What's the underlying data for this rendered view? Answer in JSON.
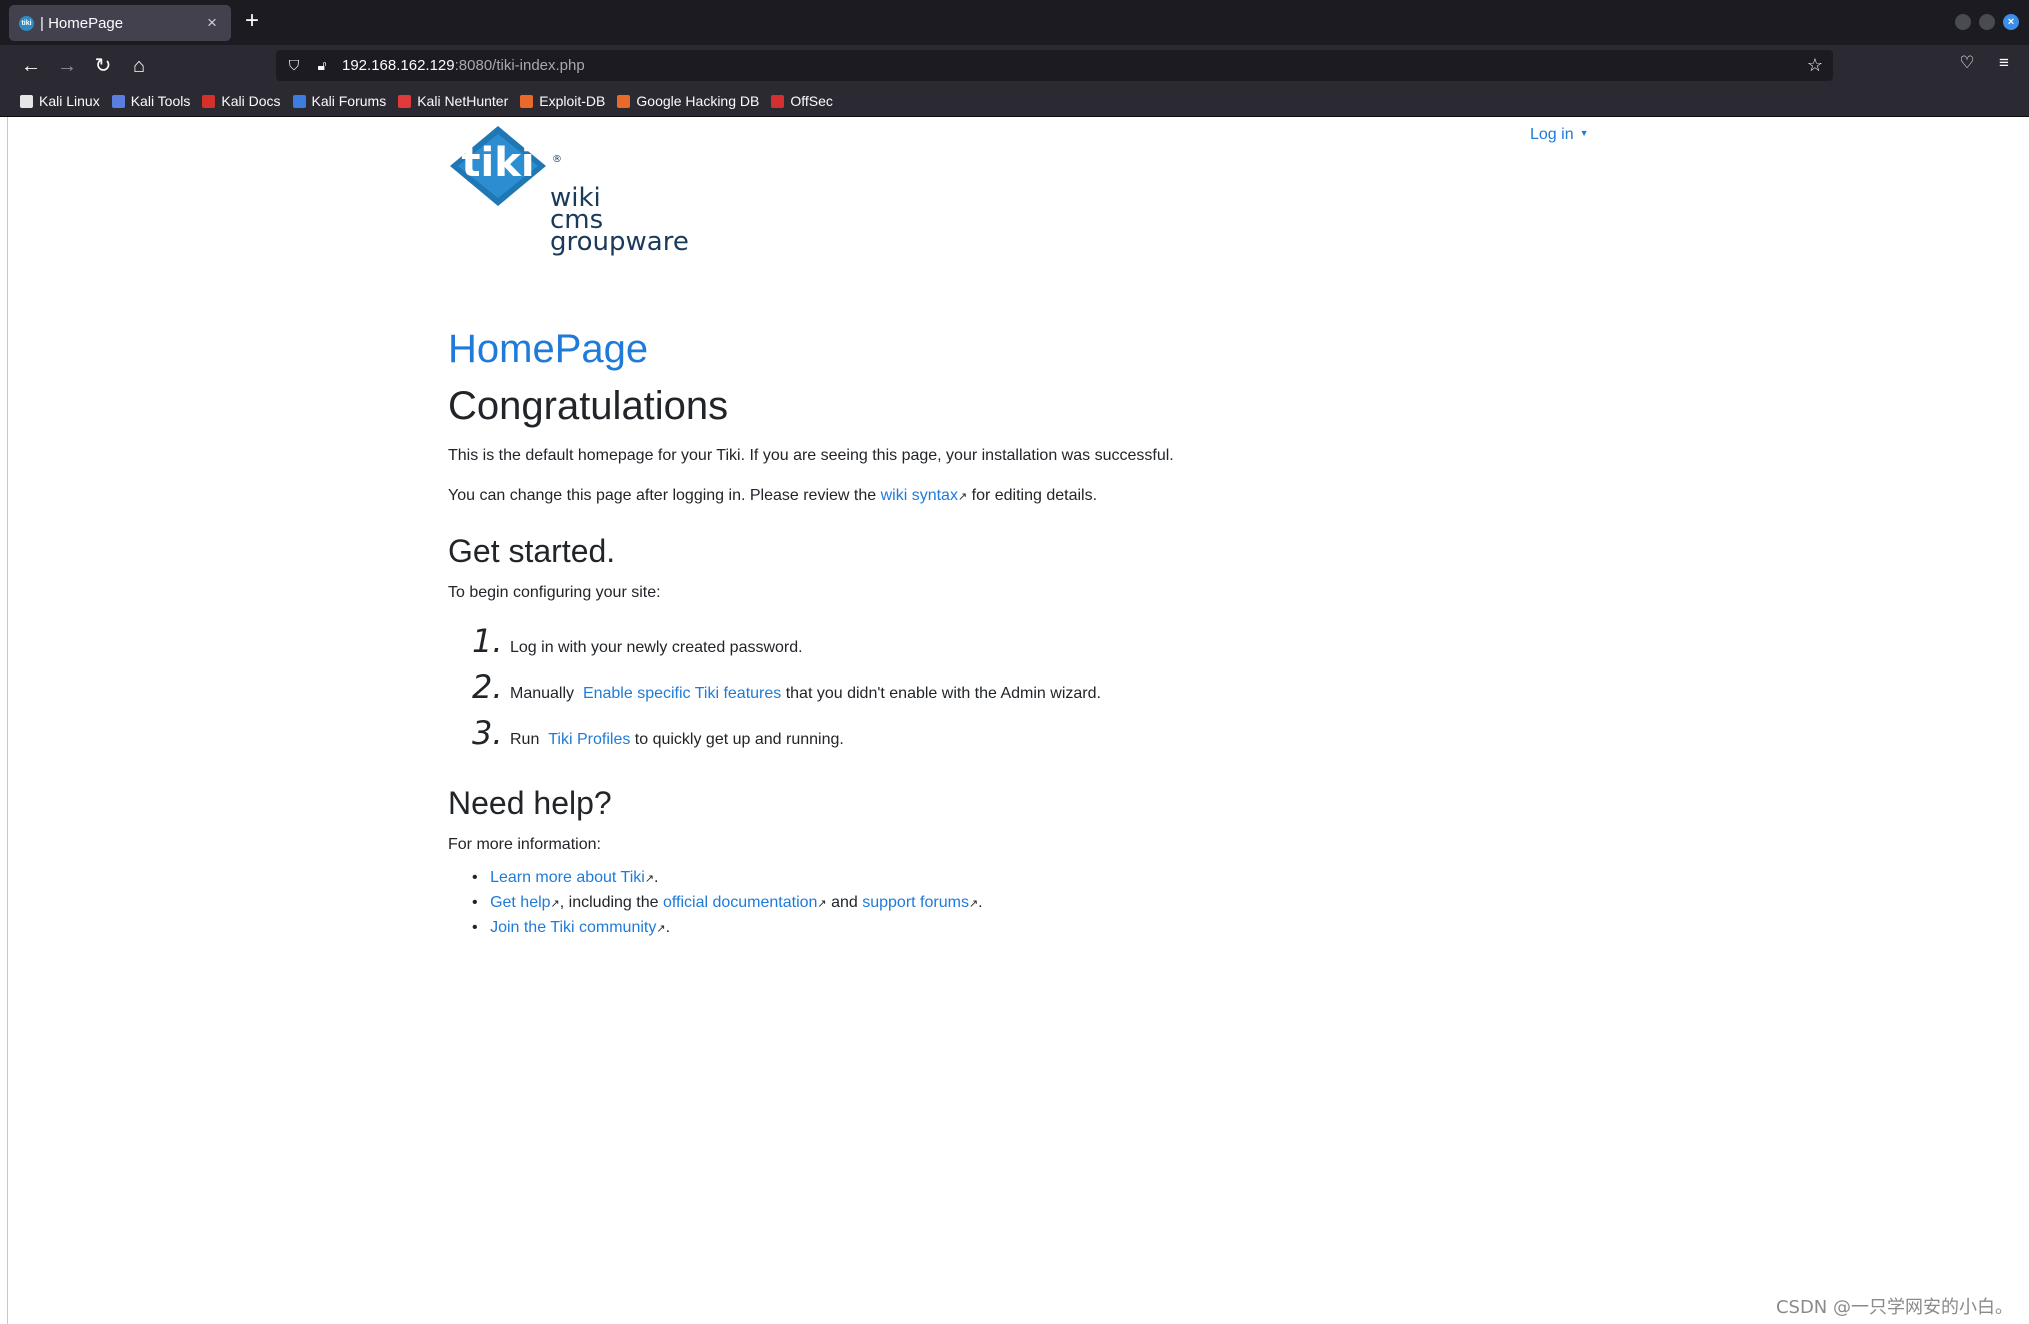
{
  "browser": {
    "tab_title": "| HomePage",
    "tab_favicon_text": "tiki",
    "url_host": "192.168.162.129",
    "url_rest": ":8080/tiki-index.php",
    "bookmarks": [
      {
        "label": "Kali Linux",
        "color": "#e6e6e6"
      },
      {
        "label": "Kali Tools",
        "color": "#5a7de0"
      },
      {
        "label": "Kali Docs",
        "color": "#d4312a"
      },
      {
        "label": "Kali Forums",
        "color": "#3b7de0"
      },
      {
        "label": "Kali NetHunter",
        "color": "#e03b3b"
      },
      {
        "label": "Exploit-DB",
        "color": "#e8692a"
      },
      {
        "label": "Google Hacking DB",
        "color": "#e8692a"
      },
      {
        "label": "OffSec",
        "color": "#d43030"
      }
    ]
  },
  "header": {
    "login_label": "Log in"
  },
  "logo": {
    "brand": "tiki",
    "registered": "®",
    "line1": "wiki",
    "line2": "cms",
    "line3": "groupware"
  },
  "main": {
    "page_title": "HomePage",
    "heading": "Congratulations",
    "intro": "This is the default homepage for your Tiki. If you are seeing this page, your installation was successful.",
    "review_before": "You can change this page after logging in. Please review the ",
    "review_link": "wiki syntax",
    "review_after": " for editing details.",
    "get_started_heading": "Get started.",
    "get_started_intro": "To begin configuring your site:",
    "steps": [
      {
        "num": "1.",
        "before": "Log in with your newly created password.",
        "link": "",
        "after": ""
      },
      {
        "num": "2.",
        "before": "Manually ",
        "link": "Enable specific Tiki features",
        "after": " that you didn't enable with the Admin wizard."
      },
      {
        "num": "3.",
        "before": "Run ",
        "link": "Tiki Profiles",
        "after": " to quickly get up and running."
      }
    ],
    "help_heading": "Need help?",
    "help_intro": "For more information:",
    "help_items": {
      "learn_link": "Learn more about Tiki",
      "learn_after": ".",
      "gethelp_link": "Get help",
      "gethelp_mid": ", including the ",
      "docs_link": "official documentation",
      "and": " and ",
      "forums_link": "support forums",
      "forums_after": ".",
      "community_link": "Join the Tiki community",
      "community_after": "."
    }
  },
  "watermark": "CSDN @一只学网安的小白。",
  "colors": {
    "link": "#1e7bd9",
    "text": "#212529",
    "logo_blue": "#1f77b4",
    "logo_text": "#1a3a5c"
  }
}
